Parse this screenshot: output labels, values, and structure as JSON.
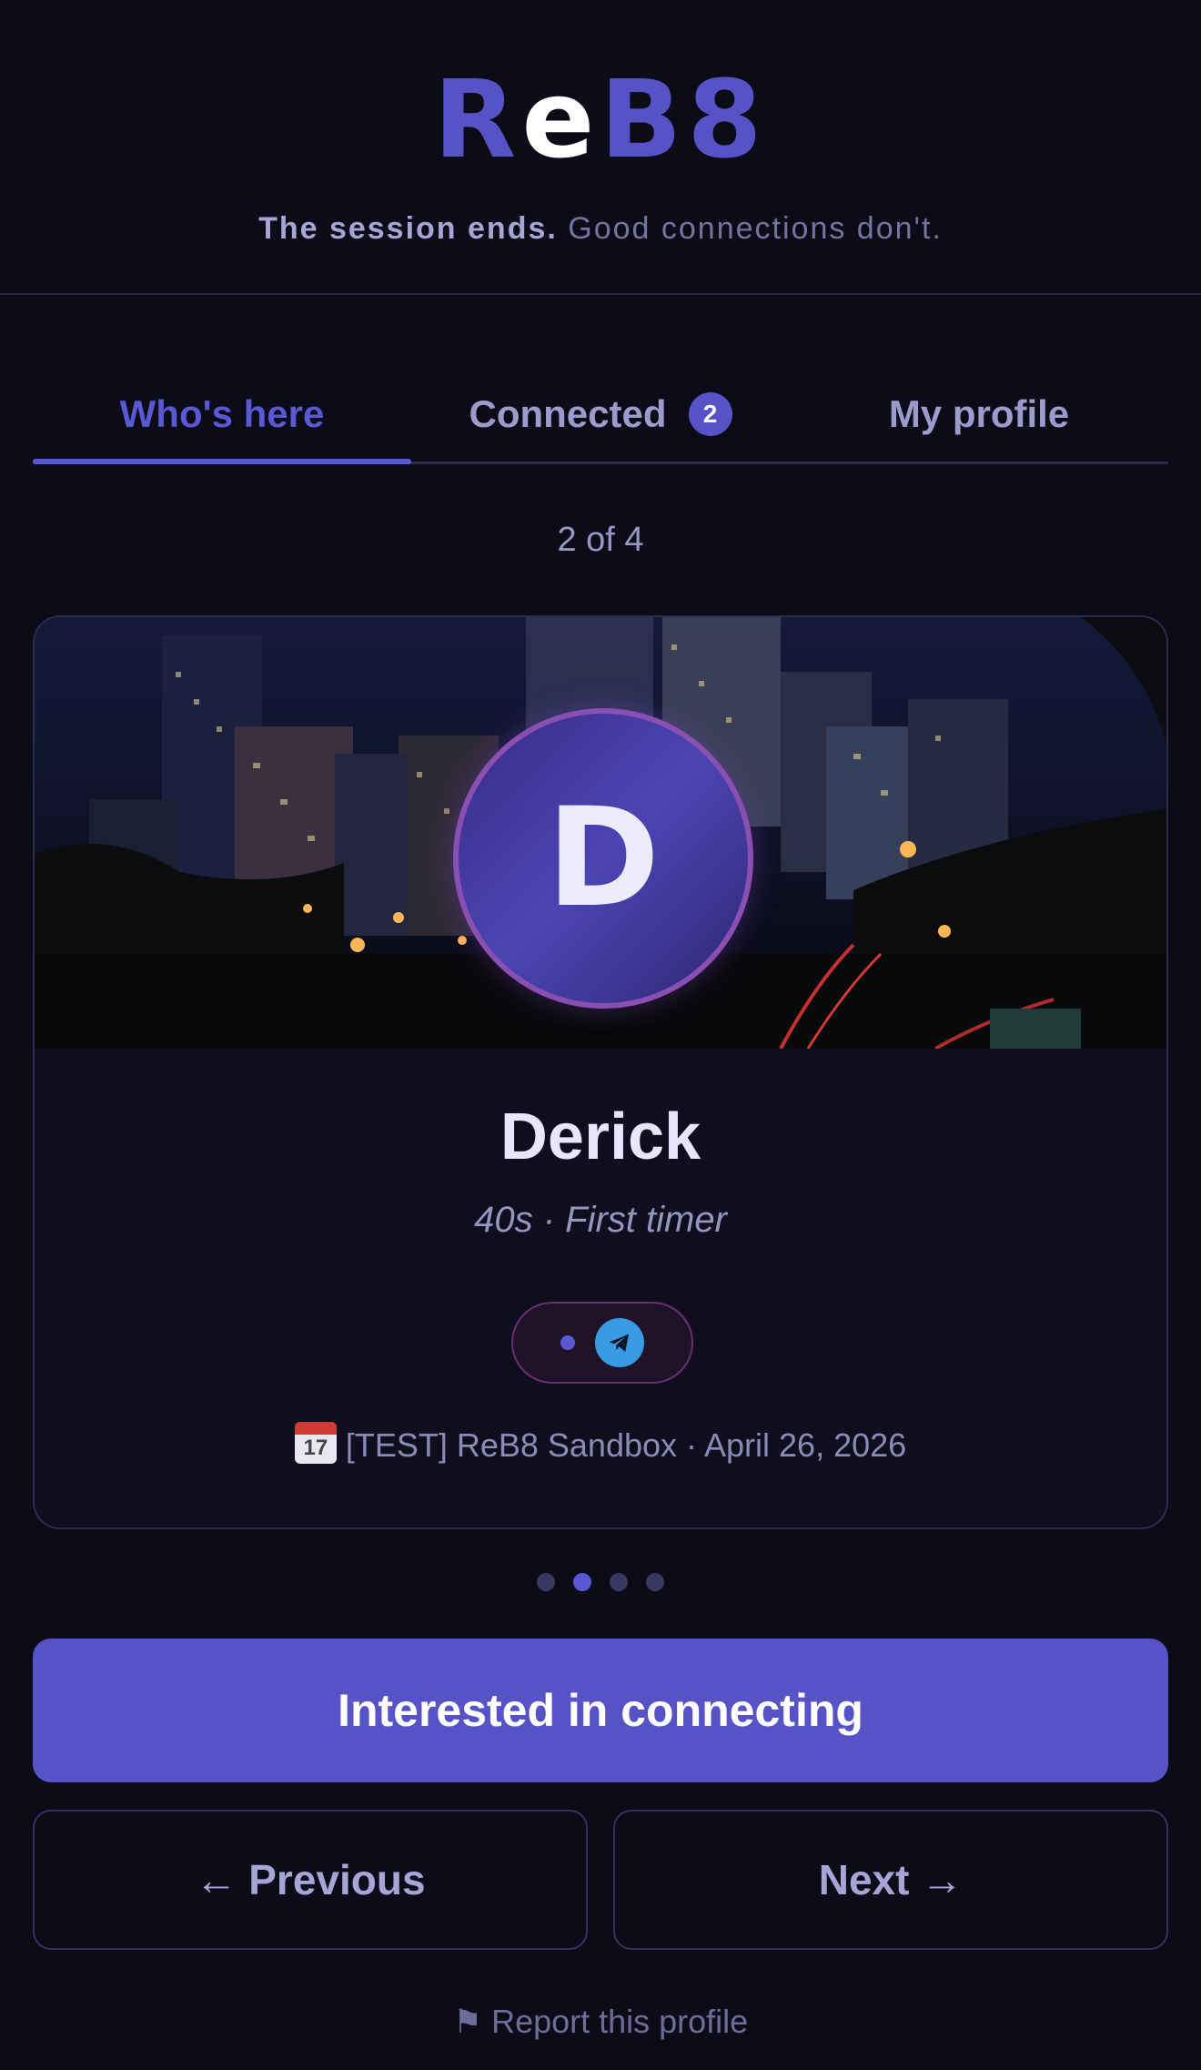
{
  "header": {
    "logo": {
      "part1": "Re",
      "part2": "e",
      "part3": "B8"
    },
    "tagline_bold": "The session ends.",
    "tagline_rest": " Good connections don't."
  },
  "tabs": [
    {
      "label": "Who's here",
      "active": true
    },
    {
      "label": "Connected",
      "badge": "2",
      "active": false
    },
    {
      "label": "My profile",
      "active": false
    }
  ],
  "counter": "2 of 4",
  "profile": {
    "initial": "D",
    "name": "Derick",
    "meta": "40s · First timer",
    "contact_icon": "telegram-icon",
    "event_icon": "calendar-icon",
    "calendar_day": "17",
    "event": "[TEST] ReB8 Sandbox · April 26, 2026"
  },
  "pagination": {
    "current": 2,
    "total": 4
  },
  "actions": {
    "primary": "Interested in connecting",
    "previous": "← Previous",
    "next": "Next →"
  },
  "report": "⚑ Report this profile",
  "colors": {
    "accent": "#5753c6",
    "background": "#0c0b18",
    "telegram": "#3a9be3"
  }
}
